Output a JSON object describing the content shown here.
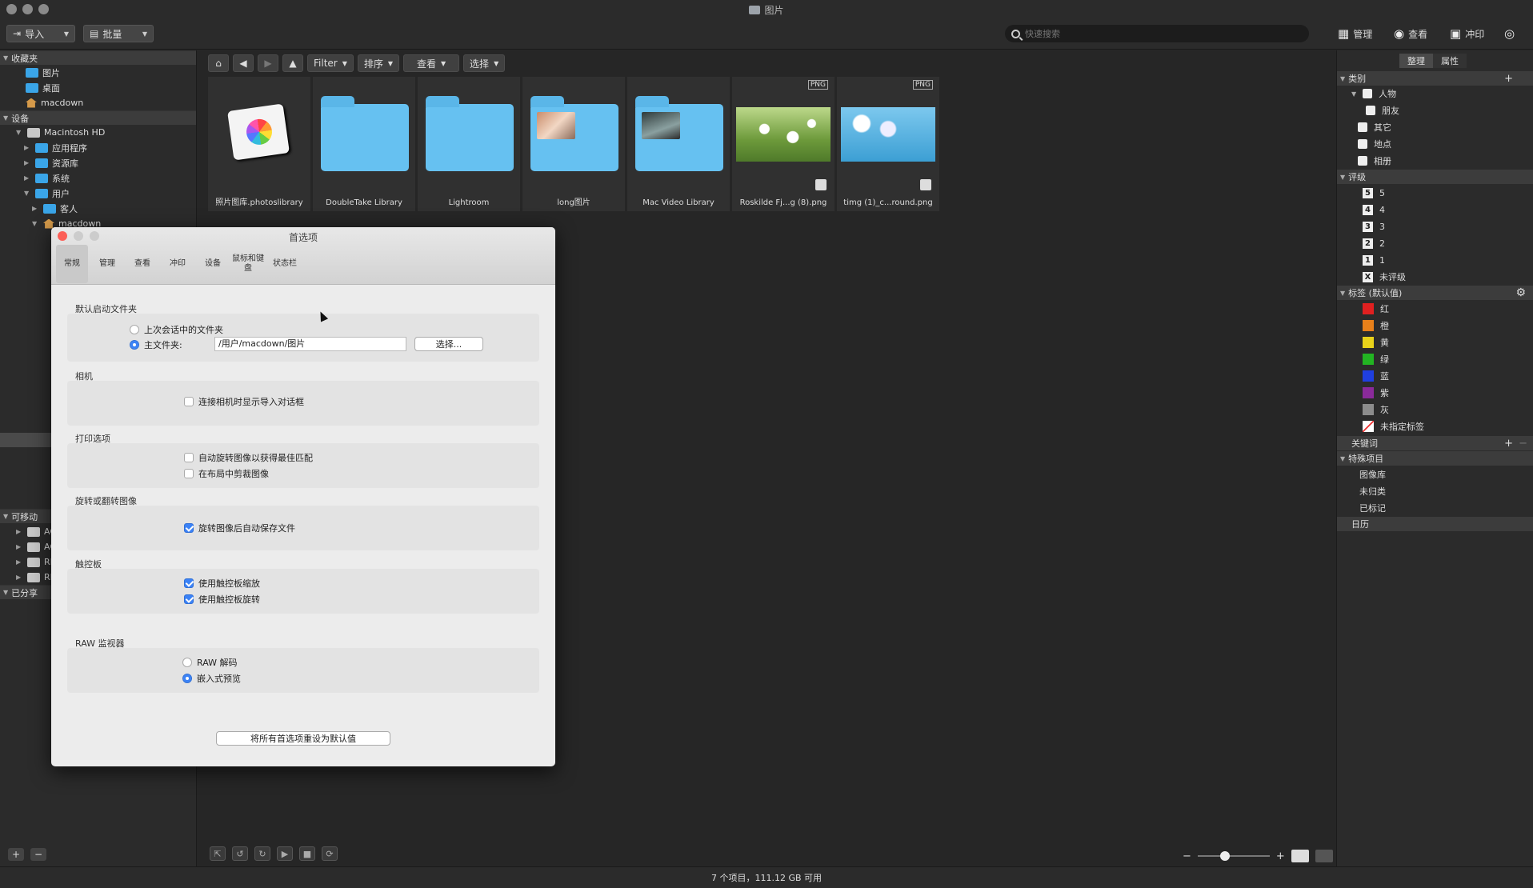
{
  "window": {
    "title": "图片"
  },
  "toolbar": {
    "import_label": "导入",
    "batch_label": "批量",
    "search_placeholder": "快速搜索",
    "modes": [
      {
        "icon": "grid-icon",
        "label": "管理"
      },
      {
        "icon": "eye-icon",
        "label": "查看"
      },
      {
        "icon": "print-icon",
        "label": "冲印"
      }
    ]
  },
  "sidebar": {
    "favorites": {
      "label": "收藏夹",
      "items": [
        "图片",
        "桌面",
        "macdown"
      ]
    },
    "devices": {
      "label": "设备",
      "hd": "Macintosh HD",
      "items": [
        "应用程序",
        "资源库",
        "系统",
        "用户",
        "客人",
        "macdown"
      ]
    },
    "removable": {
      "label": "可移动",
      "items": [
        "AC",
        "AC",
        "RI",
        "RI"
      ]
    },
    "shared": {
      "label": "已分享"
    }
  },
  "nav": {
    "filter": "Filter",
    "sort": "排序",
    "view": "查看",
    "select": "选择"
  },
  "thumbnails": [
    {
      "caption": "照片图库.photoslibrary",
      "kind": "photos"
    },
    {
      "caption": "DoubleTake Library",
      "kind": "folder"
    },
    {
      "caption": "Lightroom",
      "kind": "folder"
    },
    {
      "caption": "long图片",
      "kind": "folder-preview"
    },
    {
      "caption": "Mac Video Library",
      "kind": "folder-preview"
    },
    {
      "caption": "Roskilde Fj...g (8).png",
      "kind": "image",
      "badge": "PNG"
    },
    {
      "caption": "timg (1)_c...round.png",
      "kind": "image",
      "badge": "PNG"
    }
  ],
  "prefs": {
    "title": "首选项",
    "tabs": [
      "常规",
      "管理",
      "查看",
      "冲印",
      "设备",
      "鼠标和键盘",
      "状态栏"
    ],
    "startup_folder": {
      "label": "默认启动文件夹",
      "option_last": "上次会话中的文件夹",
      "option_home": "主文件夹:",
      "path": "/用户/macdown/图片",
      "choose": "选择..."
    },
    "camera": {
      "label": "相机",
      "option": "连接相机时显示导入对话框"
    },
    "print": {
      "label": "打印选项",
      "option_rotate": "自动旋转图像以获得最佳匹配",
      "option_crop": "在布局中剪裁图像"
    },
    "rotate": {
      "label": "旋转或翻转图像",
      "option": "旋转图像后自动保存文件"
    },
    "trackpad": {
      "label": "触控板",
      "option_zoom": "使用触控板缩放",
      "option_rotate": "使用触控板旋转"
    },
    "raw": {
      "label": "RAW 监视器",
      "option_decode": "RAW 解码",
      "option_embedded": "嵌入式预览"
    },
    "reset": "将所有首选项重设为默认值"
  },
  "right_panel": {
    "tabs": [
      "整理",
      "属性"
    ],
    "category": {
      "label": "类别",
      "items": [
        "人物",
        "朋友",
        "其它",
        "地点",
        "相册"
      ]
    },
    "rating": {
      "label": "评级",
      "items": [
        {
          "n": "5",
          "t": "5"
        },
        {
          "n": "4",
          "t": "4"
        },
        {
          "n": "3",
          "t": "3"
        },
        {
          "n": "2",
          "t": "2"
        },
        {
          "n": "1",
          "t": "1"
        },
        {
          "n": "X",
          "t": "未评级"
        }
      ]
    },
    "tags": {
      "label": "标签 (默认值)",
      "items": [
        {
          "name": "红",
          "color": "#e02020"
        },
        {
          "name": "橙",
          "color": "#e8801a"
        },
        {
          "name": "黄",
          "color": "#e8d21a"
        },
        {
          "name": "绿",
          "color": "#22b422"
        },
        {
          "name": "蓝",
          "color": "#1f3fe0"
        },
        {
          "name": "紫",
          "color": "#8a2a9a"
        },
        {
          "name": "灰",
          "color": "#8c8c8c"
        },
        {
          "name": "未指定标签",
          "color": "#ffffff"
        }
      ]
    },
    "keywords": {
      "label": "关键词"
    },
    "special": {
      "label": "特殊项目",
      "items": [
        "图像库",
        "未归类",
        "已标记"
      ]
    },
    "calendar": {
      "label": "日历"
    }
  },
  "status": {
    "text": "7 个项目，111.12 GB 可用"
  }
}
